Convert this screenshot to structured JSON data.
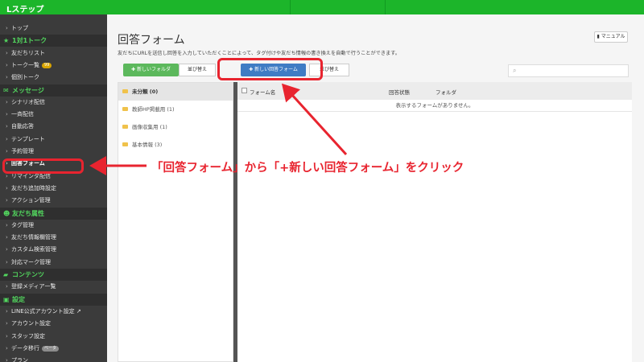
{
  "header": {
    "brand": "Lステップ"
  },
  "sidebar": {
    "items": [
      {
        "type": "item",
        "label": "トップ"
      },
      {
        "type": "section",
        "label": "1対1トーク",
        "icon": "star-icon"
      },
      {
        "type": "item",
        "label": "友だちリスト"
      },
      {
        "type": "item",
        "label": "トーク一覧",
        "badge": "99"
      },
      {
        "type": "item",
        "label": "個別トーク"
      },
      {
        "type": "section",
        "label": "メッセージ",
        "icon": "mail-icon"
      },
      {
        "type": "item",
        "label": "シナリオ配信"
      },
      {
        "type": "item",
        "label": "一斉配信"
      },
      {
        "type": "item",
        "label": "自動応答"
      },
      {
        "type": "item",
        "label": "テンプレート"
      },
      {
        "type": "item",
        "label": "予約管理"
      },
      {
        "type": "item",
        "label": "回答フォーム",
        "selected": true
      },
      {
        "type": "item",
        "label": "リマインダ配信"
      },
      {
        "type": "item",
        "label": "友だち追加時設定"
      },
      {
        "type": "item",
        "label": "アクション管理"
      },
      {
        "type": "section",
        "label": "友だち属性",
        "icon": "people-icon"
      },
      {
        "type": "item",
        "label": "タグ管理"
      },
      {
        "type": "item",
        "label": "友だち情報欄管理"
      },
      {
        "type": "item",
        "label": "カスタム検索管理"
      },
      {
        "type": "item",
        "label": "対応マーク管理"
      },
      {
        "type": "section",
        "label": "コンテンツ",
        "icon": "folder-icon"
      },
      {
        "type": "item",
        "label": "登録メディア一覧"
      },
      {
        "type": "section",
        "label": "設定",
        "icon": "settings-icon"
      },
      {
        "type": "item",
        "label": "LINE公式アカウント設定 ↗"
      },
      {
        "type": "item",
        "label": "アカウント設定"
      },
      {
        "type": "item",
        "label": "スタッフ設定"
      },
      {
        "type": "item",
        "label": "データ移行",
        "badge": "ベータ",
        "badge_style": "gray"
      },
      {
        "type": "item",
        "label": "プラン"
      }
    ]
  },
  "main": {
    "title": "回答フォーム",
    "manual_label": "マニュアル",
    "description": "友だちにURLを送信し回答を入力していただくことによって、タグ付けや友だち情報の書き換えを自動で行うことができます。",
    "new_folder_label": "新しいフォルダ",
    "sort_label": "並び替え",
    "new_form_label": "新しい回答フォーム",
    "sort_label_2": "並び替え",
    "search_placeholder": ""
  },
  "folders": [
    {
      "label": "未分類 (0)",
      "selected": true
    },
    {
      "label": "教師HP掲載用 (1)"
    },
    {
      "label": "画像収集用 (1)"
    },
    {
      "label": "基本情報 (3)"
    }
  ],
  "table": {
    "columns": [
      "フォーム名",
      "回答状態",
      "フォルダ"
    ],
    "empty_message": "表示するフォームがありません。"
  },
  "annotation": {
    "instruction": "「回答フォーム」から「+新しい回答フォーム」をクリック",
    "color": "#e8242f"
  },
  "colors": {
    "brand_green": "#1cb52a",
    "sidebar_bg": "#3b3b3b",
    "section_green": "#52d65e",
    "primary_blue": "#3f7cc4",
    "success_green": "#5cb85c"
  }
}
